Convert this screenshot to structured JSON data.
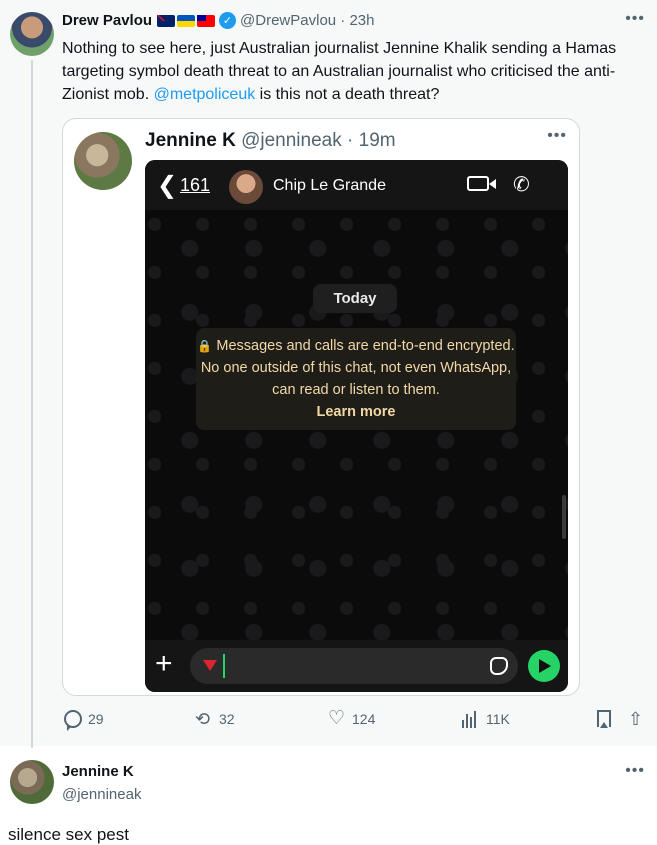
{
  "main_tweet": {
    "author_name": "Drew Pavlou",
    "handle": "@DrewPavlou",
    "time": "23h",
    "text_parts": [
      "Nothing to see here, just Australian journalist Jennine Khalik sending a Hamas targeting symbol death threat to an Australian journalist who criticised the anti-Zionist mob. ",
      "@metpoliceuk",
      " is this not a death threat?"
    ],
    "flags": [
      "australia-flag-icon",
      "ukraine-flag-icon",
      "taiwan-flag-icon"
    ],
    "verified_icon": "verified-badge-icon"
  },
  "quoted_tweet": {
    "author_name": "Jennine K",
    "handle": "@jennineak",
    "time": "19m"
  },
  "whatsapp": {
    "back_count": "161",
    "contact_name": "Chip Le Grande",
    "date_chip": "Today",
    "encryption_notice": "Messages and calls are end-to-end encrypted. No one outside of this chat, not even WhatsApp, can read or listen to them.",
    "learn_more": "Learn more",
    "lock_glyph": "🔒",
    "colors": {
      "send": "#25d366",
      "notice_text": "#f2d8a7",
      "triangle": "#d9252f"
    }
  },
  "actions": {
    "replies": "29",
    "retweets": "32",
    "likes": "124",
    "views": "11K"
  },
  "reply": {
    "author_name": "Jennine K",
    "handle": "@jennineak",
    "text": "silence sex pest"
  },
  "colors": {
    "link": "#1d9bf0",
    "muted": "#536471",
    "border": "#cfd9de"
  }
}
